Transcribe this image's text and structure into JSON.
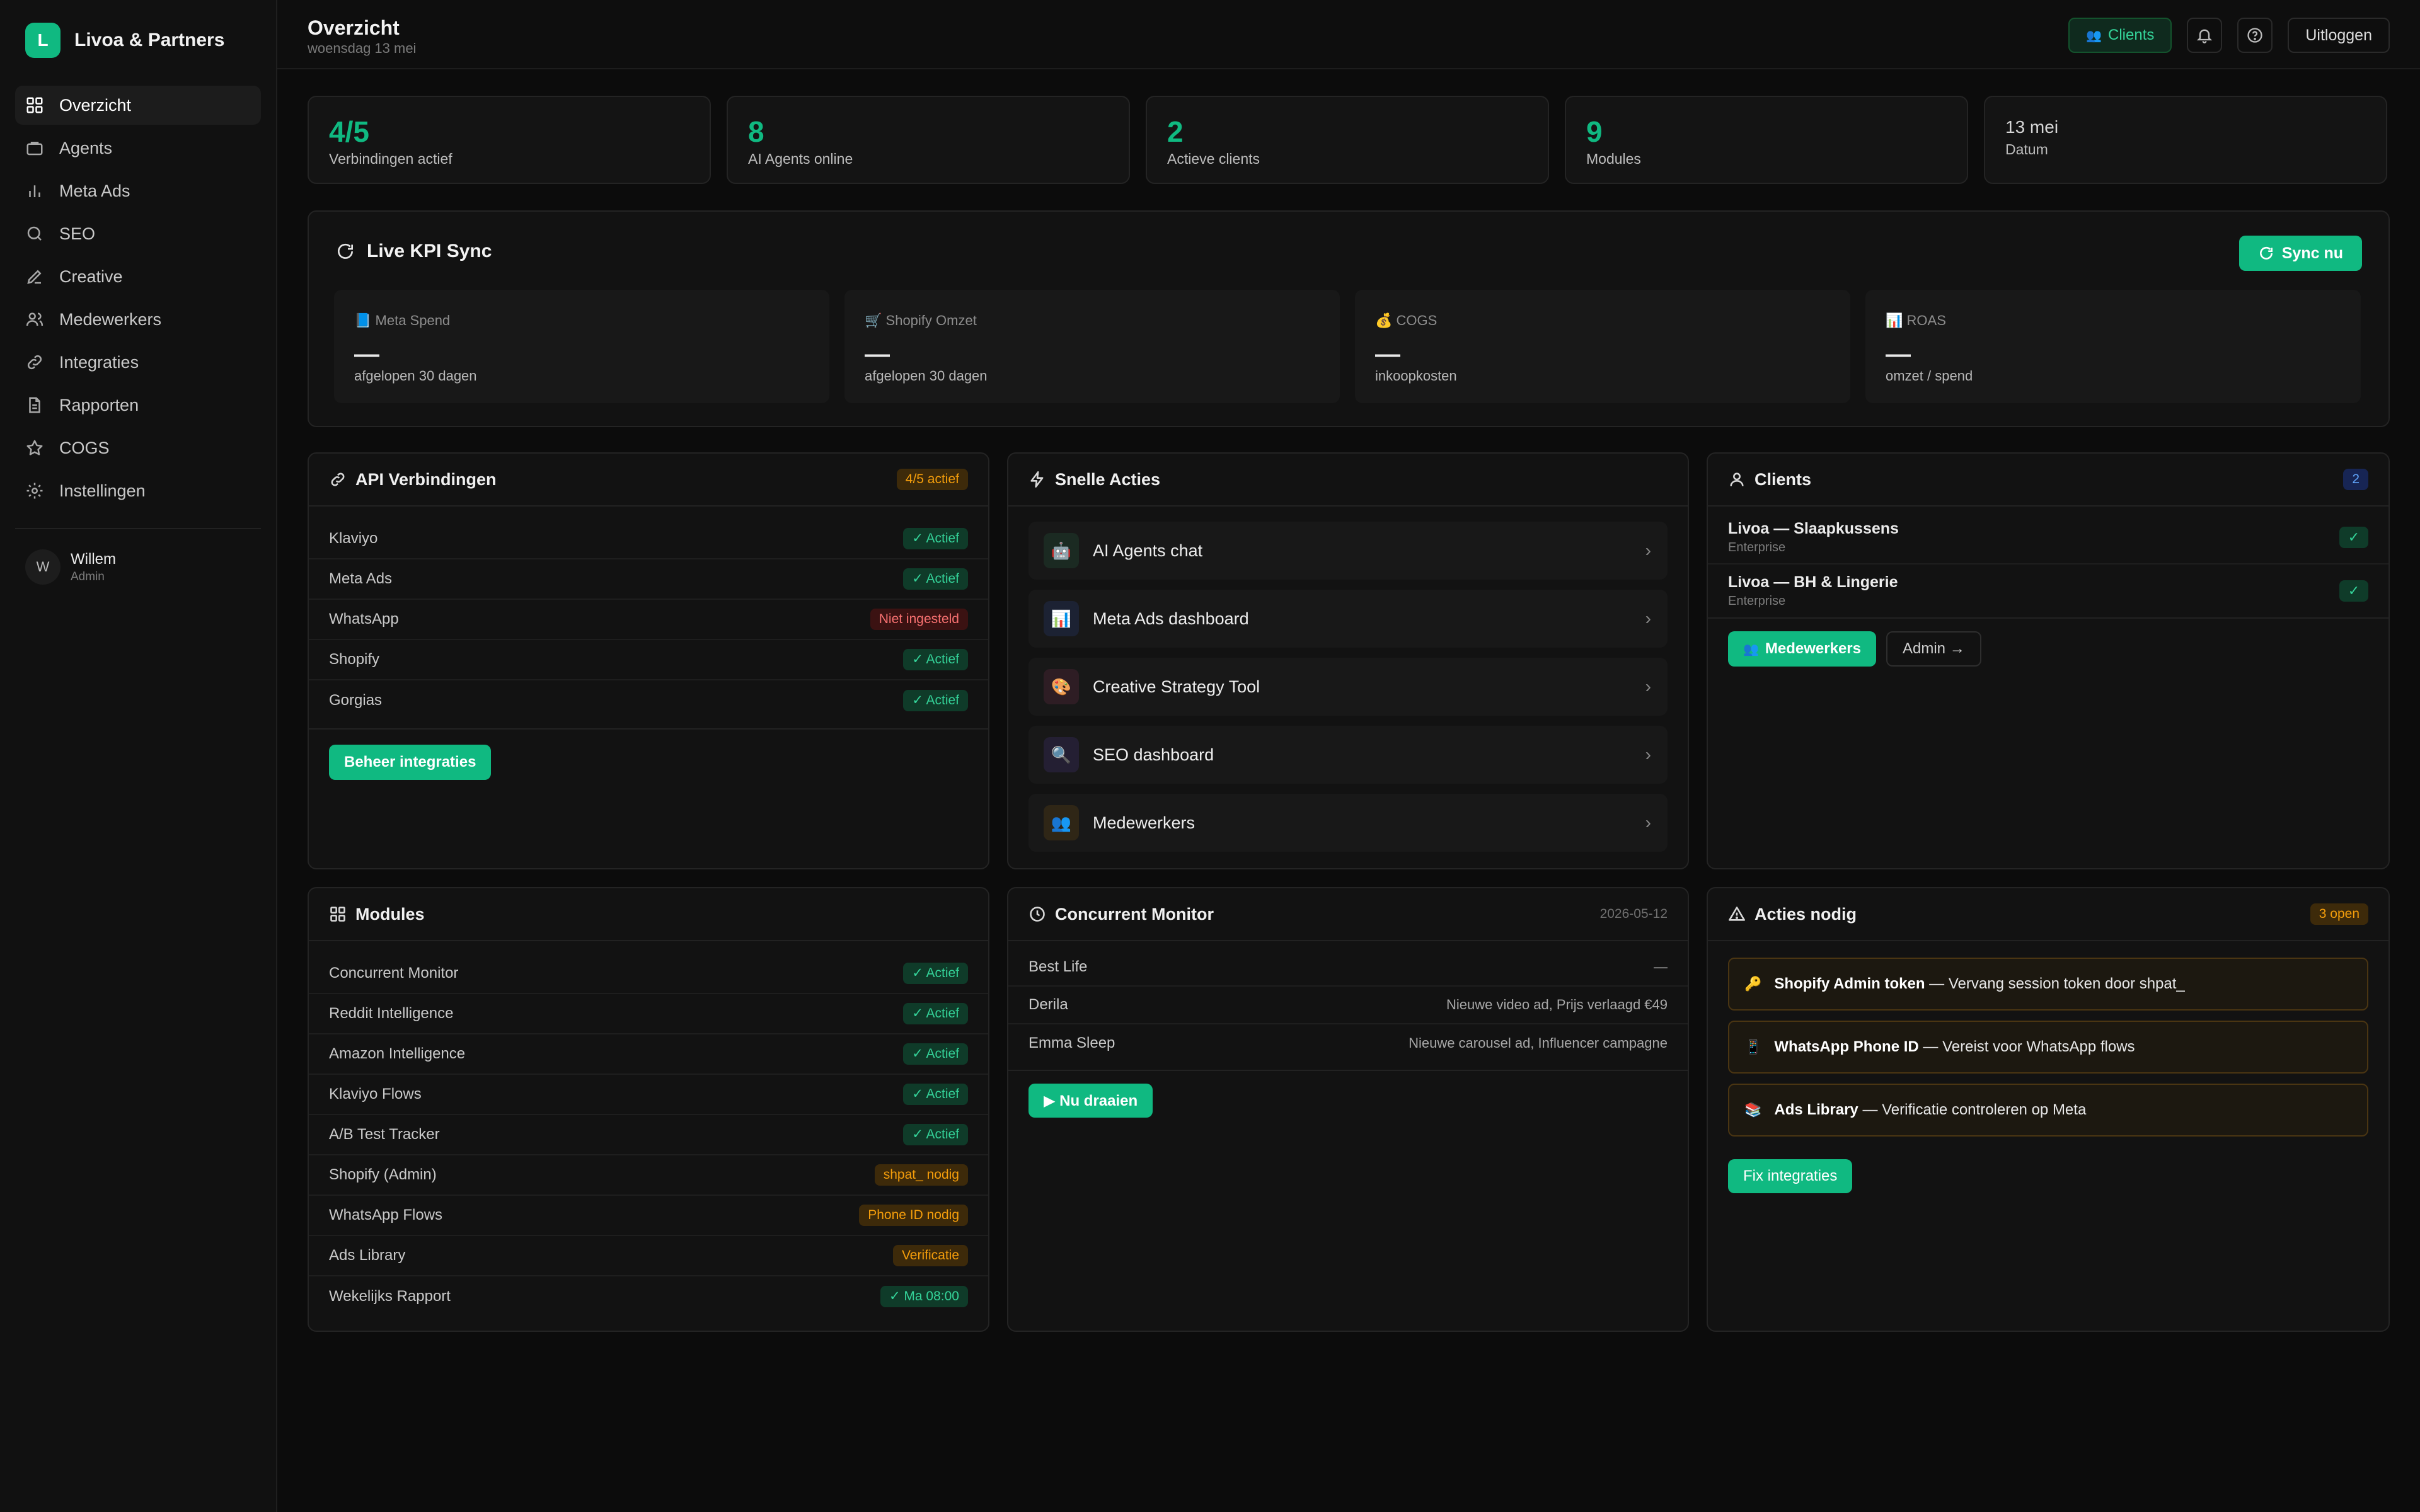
{
  "brand": {
    "logo_letter": "L",
    "name": "Livoa & Partners"
  },
  "nav": [
    {
      "label": "Overzicht",
      "icon": "grid-icon",
      "active": true
    },
    {
      "label": "Agents",
      "icon": "briefcase-icon"
    },
    {
      "label": "Meta Ads",
      "icon": "bar-chart-icon"
    },
    {
      "label": "SEO",
      "icon": "search-icon"
    },
    {
      "label": "Creative",
      "icon": "pen-icon"
    },
    {
      "label": "Medewerkers",
      "icon": "users-icon"
    },
    {
      "label": "Integraties",
      "icon": "link-icon"
    },
    {
      "label": "Rapporten",
      "icon": "document-icon"
    },
    {
      "label": "COGS",
      "icon": "star-icon"
    },
    {
      "label": "Instellingen",
      "icon": "gear-icon"
    }
  ],
  "user": {
    "initial": "W",
    "name": "Willem",
    "role": "Admin"
  },
  "header": {
    "title": "Overzicht",
    "date": "woensdag 13 mei",
    "clients_emoji": "👥",
    "clients_label": "Clients",
    "logout_label": "Uitloggen"
  },
  "stats": [
    {
      "value": "4/5",
      "label": "Verbindingen actief"
    },
    {
      "value": "8",
      "label": "AI Agents online"
    },
    {
      "value": "2",
      "label": "Actieve clients"
    },
    {
      "value": "9",
      "label": "Modules"
    },
    {
      "value": "13 mei",
      "label": "Datum"
    }
  ],
  "kpi": {
    "title": "Live KPI Sync",
    "sync_label": "Sync nu",
    "cards": [
      {
        "emoji": "📘",
        "label": "Meta Spend",
        "value": "—",
        "sub": "afgelopen 30 dagen"
      },
      {
        "emoji": "🛒",
        "label": "Shopify Omzet",
        "value": "—",
        "sub": "afgelopen 30 dagen"
      },
      {
        "emoji": "💰",
        "label": "COGS",
        "value": "—",
        "sub": "inkoopkosten"
      },
      {
        "emoji": "📊",
        "label": "ROAS",
        "value": "—",
        "sub": "omzet / spend"
      }
    ]
  },
  "api": {
    "title": "API Verbindingen",
    "badge": "4/5 actief",
    "rows": [
      {
        "name": "Klaviyo",
        "status": "✓ Actief",
        "tone": "green"
      },
      {
        "name": "Meta Ads",
        "status": "✓ Actief",
        "tone": "green"
      },
      {
        "name": "WhatsApp",
        "status": "Niet ingesteld",
        "tone": "red"
      },
      {
        "name": "Shopify",
        "status": "✓ Actief",
        "tone": "green"
      },
      {
        "name": "Gorgias",
        "status": "✓ Actief",
        "tone": "green"
      }
    ],
    "button": "Beheer integraties"
  },
  "quick": {
    "title": "Snelle Acties",
    "items": [
      {
        "emoji": "🤖",
        "label": "AI Agents chat",
        "bg": "#1b2a22"
      },
      {
        "emoji": "📊",
        "label": "Meta Ads dashboard",
        "bg": "#1c2233"
      },
      {
        "emoji": "🎨",
        "label": "Creative Strategy Tool",
        "bg": "#2e1d24"
      },
      {
        "emoji": "🔍",
        "label": "SEO dashboard",
        "bg": "#241f33"
      },
      {
        "emoji": "👥",
        "label": "Medewerkers",
        "bg": "#2f2616"
      }
    ],
    "chevron": "›"
  },
  "clients": {
    "title": "Clients",
    "count": "2",
    "rows": [
      {
        "name": "Livoa — Slaapkussens",
        "tier": "Enterprise",
        "check": "✓"
      },
      {
        "name": "Livoa — BH & Lingerie",
        "tier": "Enterprise",
        "check": "✓"
      }
    ],
    "btn_staff_emoji": "👥",
    "btn_staff": "Medewerkers",
    "btn_admin": "Admin →"
  },
  "modules": {
    "title": "Modules",
    "rows": [
      {
        "name": "Concurrent Monitor",
        "status": "✓ Actief",
        "tone": "green"
      },
      {
        "name": "Reddit Intelligence",
        "status": "✓ Actief",
        "tone": "green"
      },
      {
        "name": "Amazon Intelligence",
        "status": "✓ Actief",
        "tone": "green"
      },
      {
        "name": "Klaviyo Flows",
        "status": "✓ Actief",
        "tone": "green"
      },
      {
        "name": "A/B Test Tracker",
        "status": "✓ Actief",
        "tone": "green"
      },
      {
        "name": "Shopify (Admin)",
        "status": "shpat_ nodig",
        "tone": "amber"
      },
      {
        "name": "WhatsApp Flows",
        "status": "Phone ID nodig",
        "tone": "amber"
      },
      {
        "name": "Ads Library",
        "status": "Verificatie",
        "tone": "amber"
      },
      {
        "name": "Wekelijks Rapport",
        "status": "✓ Ma 08:00",
        "tone": "green"
      }
    ]
  },
  "monitor": {
    "title": "Concurrent Monitor",
    "date": "2026-05-12",
    "rows": [
      {
        "name": "Best Life",
        "note": "—"
      },
      {
        "name": "Derila",
        "note": "Nieuwe video ad, Prijs verlaagd €49"
      },
      {
        "name": "Emma Sleep",
        "note": "Nieuwe carousel ad, Influencer campagne"
      }
    ],
    "button": "▶ Nu draaien"
  },
  "actions": {
    "title": "Acties nodig",
    "badge": "3 open",
    "items": [
      {
        "emoji": "🔑",
        "title": "Shopify Admin token",
        "text": " — Vervang session token door shpat_"
      },
      {
        "emoji": "📱",
        "title": "WhatsApp Phone ID",
        "text": " — Vereist voor WhatsApp flows"
      },
      {
        "emoji": "📚",
        "title": "Ads Library",
        "text": " — Verificatie controleren op Meta"
      }
    ],
    "button": "Fix integraties"
  },
  "colors": {
    "accent": "#10b981",
    "amber": "#f59e0b",
    "red": "#f87171",
    "blue": "#60a5fa"
  }
}
